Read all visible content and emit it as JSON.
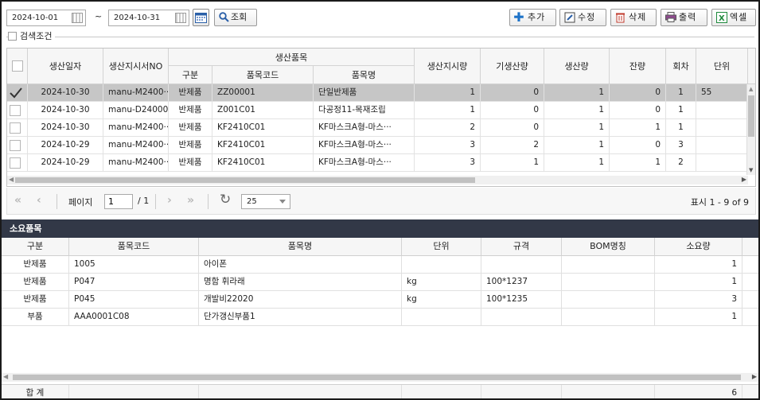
{
  "search": {
    "date_from": "2024-10-01",
    "tilde": "~",
    "date_to": "2024-10-31",
    "search_label": "조회",
    "condition_label": "검색조건"
  },
  "toolbar": {
    "add": "추가",
    "edit": "수정",
    "delete": "삭제",
    "print": "출력",
    "excel": "엑셀"
  },
  "grid": {
    "headers": {
      "date": "생산일자",
      "order_no": "생산지시서NO",
      "product_group": "생산품목",
      "type": "구분",
      "item_code": "품목코드",
      "item_name": "품목명",
      "order_qty": "생산지시량",
      "prev_qty": "기생산량",
      "prod_qty": "생산량",
      "remain": "잔량",
      "round": "회차",
      "unit": "단위"
    },
    "rows": [
      {
        "checked": true,
        "date": "2024-10-30",
        "order_no": "manu-M2400···",
        "type": "반제품",
        "item_code": "ZZ00001",
        "item_name": "단일반제품",
        "order_qty": "1",
        "prev_qty": "0",
        "prod_qty": "1",
        "remain": "0",
        "round": "1",
        "unit": "55"
      },
      {
        "checked": false,
        "date": "2024-10-30",
        "order_no": "manu-D2400023",
        "type": "반제품",
        "item_code": "Z001C01",
        "item_name": "다공정11-목재조립",
        "order_qty": "1",
        "prev_qty": "0",
        "prod_qty": "1",
        "remain": "0",
        "round": "1",
        "unit": ""
      },
      {
        "checked": false,
        "date": "2024-10-30",
        "order_no": "manu-M2400···",
        "type": "반제품",
        "item_code": "KF2410C01",
        "item_name": "KF마스크A형-마스···",
        "order_qty": "2",
        "prev_qty": "0",
        "prod_qty": "1",
        "remain": "1",
        "round": "1",
        "unit": ""
      },
      {
        "checked": false,
        "date": "2024-10-29",
        "order_no": "manu-M2400···",
        "type": "반제품",
        "item_code": "KF2410C01",
        "item_name": "KF마스크A형-마스···",
        "order_qty": "3",
        "prev_qty": "2",
        "prod_qty": "1",
        "remain": "0",
        "round": "3",
        "unit": ""
      },
      {
        "checked": false,
        "date": "2024-10-29",
        "order_no": "manu-M2400···",
        "type": "반제품",
        "item_code": "KF2410C01",
        "item_name": "KF마스크A형-마스···",
        "order_qty": "3",
        "prev_qty": "1",
        "prod_qty": "1",
        "remain": "1",
        "round": "2",
        "unit": ""
      }
    ]
  },
  "pager": {
    "page_label": "페이지",
    "page_value": "1",
    "page_total": "/ 1",
    "page_size": "25",
    "summary": "표시 1 - 9 of 9"
  },
  "bom": {
    "title": "소요품목",
    "headers": {
      "type": "구분",
      "item_code": "품목코드",
      "item_name": "품목명",
      "unit": "단위",
      "spec": "규격",
      "bom_name": "BOM명칭",
      "qty": "소요량"
    },
    "rows": [
      {
        "type": "반제품",
        "item_code": "1005",
        "item_name": "아이폰",
        "unit": "",
        "spec": "",
        "bom_name": "",
        "qty": "1"
      },
      {
        "type": "반제품",
        "item_code": "P047",
        "item_name": "명함 휘라래",
        "unit": "kg",
        "spec": "100*1237",
        "bom_name": "",
        "qty": "1"
      },
      {
        "type": "반제품",
        "item_code": "P045",
        "item_name": "개발비22020",
        "unit": "kg",
        "spec": "100*1235",
        "bom_name": "",
        "qty": "3"
      },
      {
        "type": "부품",
        "item_code": "AAA0001C08",
        "item_name": "단가갱신부품1",
        "unit": "",
        "spec": "",
        "bom_name": "",
        "qty": "1"
      }
    ],
    "total_label": "합 계",
    "total_qty": "6"
  },
  "colors": {
    "selected_row": "#c6c6c6",
    "panel_header": "#323847",
    "add_icon": "#1e73c8",
    "delete_icon": "#c0392b",
    "excel_icon": "#1e8a3c"
  }
}
